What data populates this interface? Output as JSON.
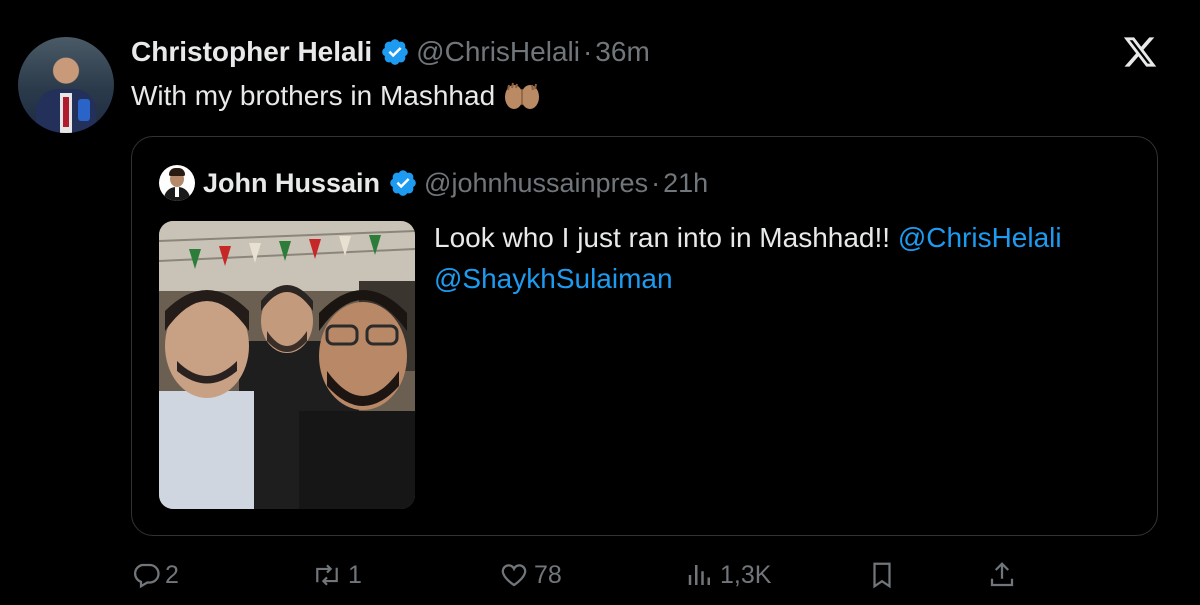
{
  "tweet": {
    "author_name": "Christopher Helali",
    "handle": "@ChrisHelali",
    "separator": "·",
    "time": "36m",
    "text": "With my brothers in Mashhad"
  },
  "quoted": {
    "author_name": "John Hussain",
    "handle": "@johnhussainpres",
    "separator": "·",
    "time": "21h",
    "text": "Look who I just ran into in Mashhad!!",
    "mentions": [
      "@ChrisHelali",
      "@ShaykhSulaiman"
    ]
  },
  "actions": {
    "replies": "2",
    "reposts": "1",
    "likes": "78",
    "views": "1,3K"
  },
  "colors": {
    "background": "#000000",
    "text": "#e7e9ea",
    "secondary": "#71767b",
    "link": "#1d9bf0",
    "verified": "#1d9bf0",
    "border": "#2f3336"
  },
  "icons": [
    "verified-badge-icon",
    "raising-hands-emoji",
    "x-logo-icon",
    "reply-icon",
    "repost-icon",
    "like-icon",
    "views-icon",
    "bookmark-icon",
    "share-icon"
  ]
}
